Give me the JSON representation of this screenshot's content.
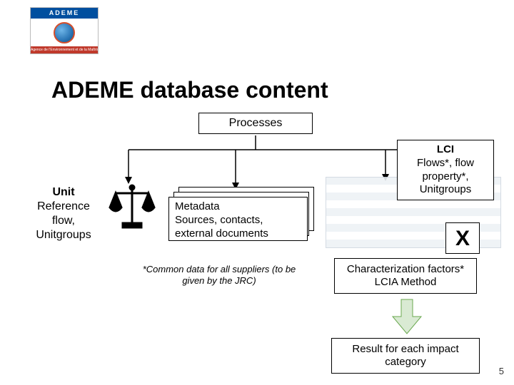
{
  "logo": {
    "brand": "ADEME",
    "tagline": "Agence de l'Environnement et de la Maîtrise de l'Énergie"
  },
  "title": "ADEME database content",
  "processes": "Processes",
  "unit": {
    "heading": "Unit",
    "body": "Reference flow, Unitgroups"
  },
  "metadata": {
    "line1": "Metadata",
    "line2": "Sources, contacts, external documents"
  },
  "lci": {
    "heading": "LCI",
    "body": "Flows*, flow property*, Unitgroups"
  },
  "x": "X",
  "char_factors": {
    "line1": "Characterization factors*",
    "line2": "LCIA Method"
  },
  "footnote": "*Common data for all suppliers (to be given by the JRC)",
  "result": "Result for each impact category",
  "page_number": "5"
}
